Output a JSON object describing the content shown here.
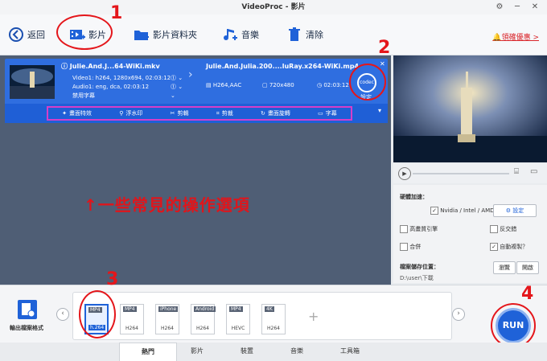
{
  "window": {
    "title": "VideoProc - 影片"
  },
  "toolbar": {
    "back_label": "返回",
    "video_label": "影片",
    "folder_label": "影片資料夾",
    "music_label": "音樂",
    "clear_label": "清除",
    "promo_label": "領確優惠 >"
  },
  "file": {
    "source_name": "Julie.And.J...64-WiKi.mkv",
    "video_info": "Video1: h264, 1280x694, 02:03:12",
    "audio_info": "Audio1: eng, dca, 02:03:12",
    "subtitle_info": "禁用字幕",
    "output_name": "Julie.And.Julia.200....luRay.x264-WiKi.mp4",
    "out_codec": "H264,AAC",
    "out_res": "720x480",
    "out_duration": "02:03:12",
    "codec_badge": "codec",
    "codec_label": "設定"
  },
  "ops": [
    {
      "icon": "magic-wand-icon",
      "label": "畫面特效"
    },
    {
      "icon": "stamp-icon",
      "label": "浮水印"
    },
    {
      "icon": "scissors-icon",
      "label": "剪輯"
    },
    {
      "icon": "crop-icon",
      "label": "剪裁"
    },
    {
      "icon": "rotate-icon",
      "label": "畫面旋轉"
    },
    {
      "icon": "subtitle-icon",
      "label": "字幕"
    }
  ],
  "annotation": {
    "text": "↑一些常見的操作選項",
    "n1": "1",
    "n2": "2",
    "n3": "3",
    "n4": "4"
  },
  "settings": {
    "hw_title": "硬體加速：",
    "hw_option": "Nvidia / Intel / AMD",
    "hw_btn": "設定",
    "hq": "高畫質引擎",
    "deinterlace": "反交錯",
    "merge": "合併",
    "autocopy": "自動複製？",
    "output_title": "檔案儲存位置：",
    "browse": "瀏覽",
    "open": "開啟",
    "path": "D:\\user\\下載"
  },
  "bottom": {
    "target_label": "輸出檔案格式",
    "formats": [
      {
        "top": "MP4",
        "codec": "h.264"
      },
      {
        "top": "MP4",
        "codec": "H264"
      },
      {
        "top": "iPhone",
        "codec": "H264"
      },
      {
        "top": "Android",
        "codec": "H264"
      },
      {
        "top": "MP4",
        "codec": "HEVC"
      },
      {
        "top": "4K",
        "codec": "H264"
      }
    ],
    "run": "RUN"
  },
  "tabs": [
    "熱門",
    "影片",
    "裝置",
    "音樂",
    "工具箱"
  ],
  "colors": {
    "accent": "#2f6ee0",
    "annotation": "#e4161b",
    "promo": "#d9262b"
  }
}
